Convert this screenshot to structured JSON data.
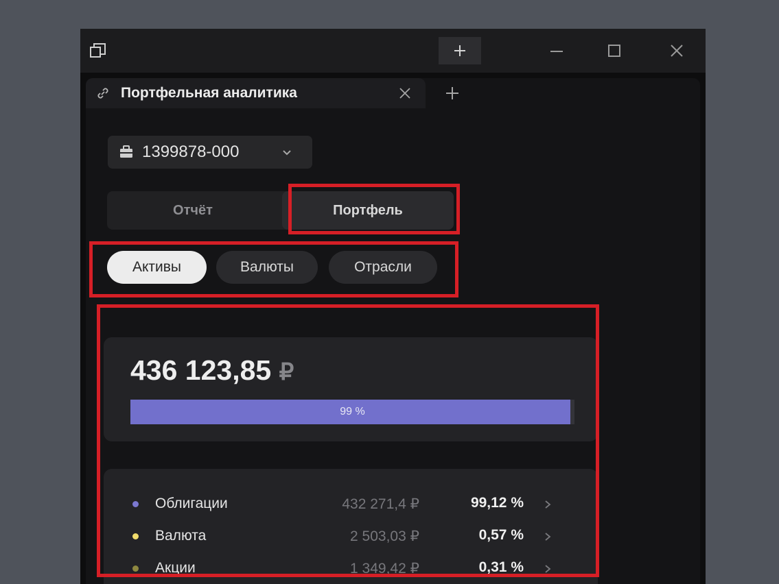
{
  "window": {
    "title_tab": "Портфельная аналитика"
  },
  "account": {
    "number": "1399878-000"
  },
  "view_toggle": {
    "options": [
      "Отчёт",
      "Портфель"
    ],
    "selected": "Портфель"
  },
  "filters": {
    "options": [
      "Активы",
      "Валюты",
      "Отрасли"
    ],
    "selected": "Активы"
  },
  "summary": {
    "total": "436 123,85",
    "currency": "₽",
    "progress_label": "99 %",
    "progress_fraction": 0.99
  },
  "assets": [
    {
      "name": "Облигации",
      "value": "432 271,4 ₽",
      "percent": "99,12 %",
      "color": "#7b78d0"
    },
    {
      "name": "Валюта",
      "value": "2 503,03 ₽",
      "percent": "0,57 %",
      "color": "#f0dc6c"
    },
    {
      "name": "Акции",
      "value": "1 349,42 ₽",
      "percent": "0,31 %",
      "color": "#8e8840"
    }
  ],
  "colors": {
    "highlight": "#d61f26",
    "accent": "#7270cc"
  }
}
